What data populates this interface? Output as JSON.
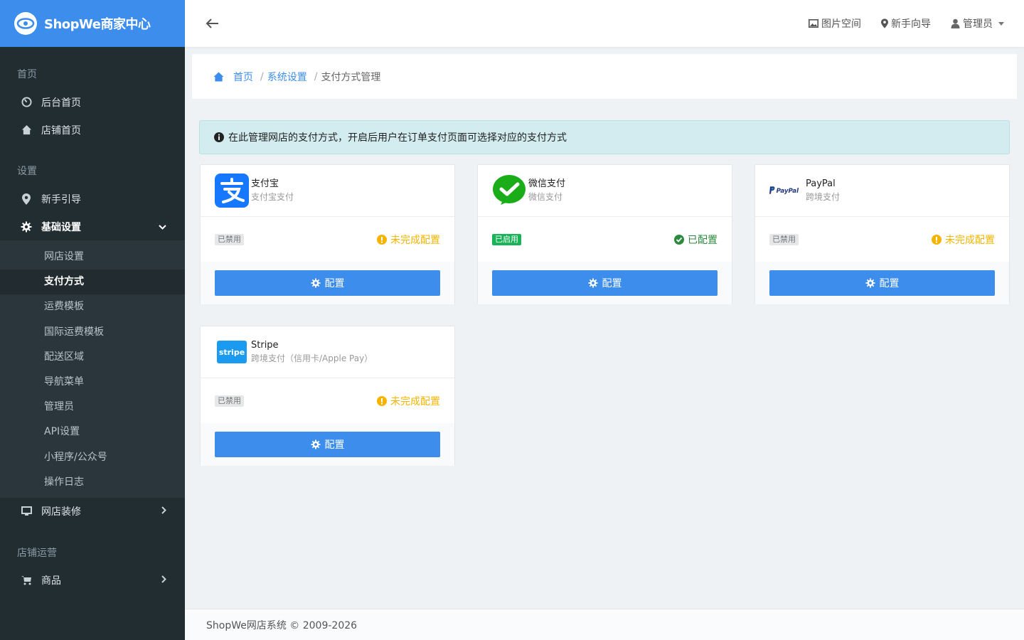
{
  "brand": {
    "title": "ShopWe商家中心"
  },
  "sidebar": {
    "sections": [
      {
        "label": "首页",
        "items": [
          {
            "label": "后台首页",
            "icon": "dashboard-icon"
          },
          {
            "label": "店铺首页",
            "icon": "home-icon"
          }
        ]
      },
      {
        "label": "设置",
        "items": [
          {
            "label": "新手引导",
            "icon": "map-marker-icon"
          },
          {
            "label": "基础设置",
            "icon": "gear-icon"
          }
        ]
      },
      {
        "label": "店铺运营",
        "items": [
          {
            "label": "商品",
            "icon": "cart-icon"
          }
        ]
      }
    ],
    "sub_items": [
      "网店设置",
      "支付方式",
      "运费模板",
      "国际运费模板",
      "配送区域",
      "导航菜单",
      "管理员",
      "API设置",
      "小程序/公众号",
      "操作日志"
    ],
    "decor_item": {
      "label": "网店装修",
      "icon": "monitor-icon"
    }
  },
  "header": {
    "links": [
      {
        "label": "图片空间",
        "icon": "image-icon"
      },
      {
        "label": "新手向导",
        "icon": "map-marker-icon"
      },
      {
        "label": "管理员",
        "icon": "user-icon"
      }
    ]
  },
  "breadcrumb": {
    "home": "首页",
    "level2": "系统设置",
    "current": "支付方式管理"
  },
  "alert": {
    "text": "在此管理网店的支付方式，开启后用户在订单支付页面可选择对应的支付方式"
  },
  "cards": [
    {
      "name": "支付宝",
      "desc": "支付宝支付",
      "badge": "已禁用",
      "state": "未完成配置",
      "button": "配置",
      "logo": "alipay-logo"
    },
    {
      "name": "微信支付",
      "desc": "微信支付",
      "badge": "已启用",
      "state": "已配置",
      "button": "配置",
      "logo": "wechat-pay-logo"
    },
    {
      "name": "PayPal",
      "desc": "跨境支付",
      "badge": "已禁用",
      "state": "未完成配置",
      "button": "配置",
      "logo": "paypal-logo",
      "logo_text": "PayPal"
    },
    {
      "name": "Stripe",
      "desc": "跨境支付（信用卡/Apple Pay）",
      "badge": "已禁用",
      "state": "未完成配置",
      "button": "配置",
      "logo": "stripe-logo",
      "logo_text": "stripe"
    }
  ],
  "footer": {
    "text": "ShopWe网店系统 © 2009-2026"
  },
  "colors": {
    "primary": "#3c8dec",
    "sidebar": "#222d32",
    "warning": "#f4b400",
    "success": "#19b45a"
  }
}
